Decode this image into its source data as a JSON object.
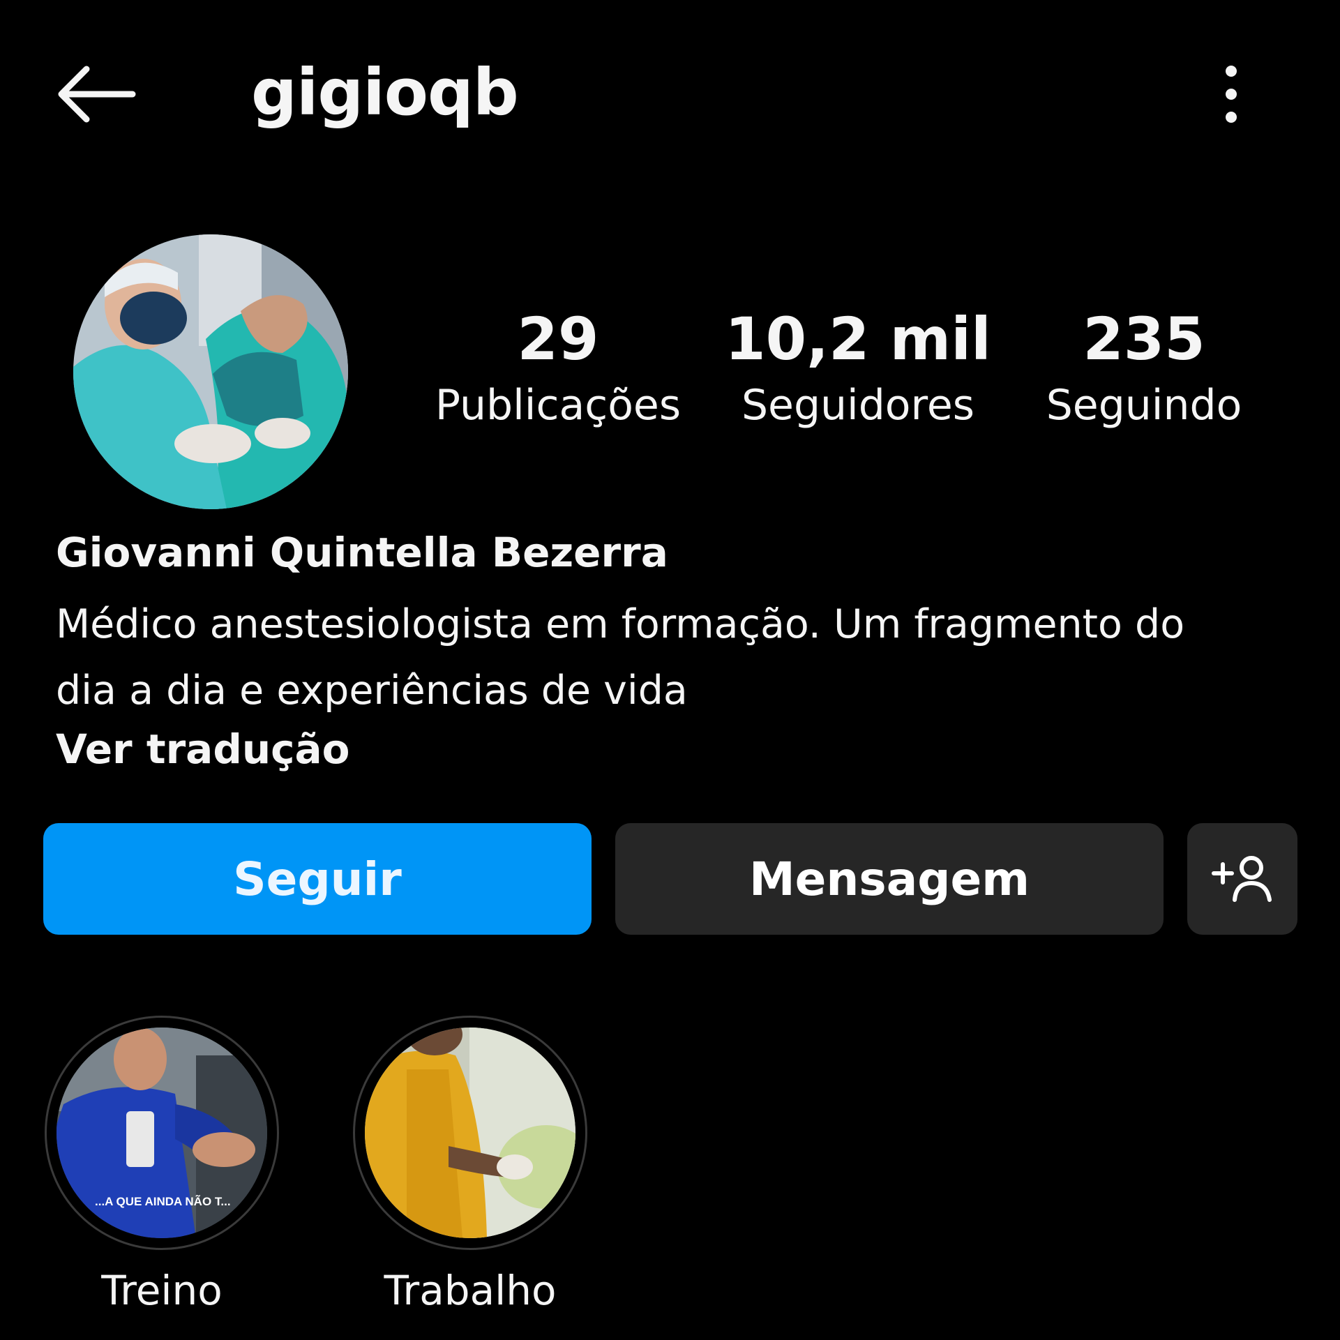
{
  "header": {
    "username": "gigioqb",
    "back_icon": "arrow-left-icon",
    "menu_icon": "more-vertical-icon"
  },
  "profile": {
    "stats": {
      "posts": {
        "value": "29",
        "label": "Publicações"
      },
      "followers": {
        "value": "10,2 mil",
        "label": "Seguidores"
      },
      "following": {
        "value": "235",
        "label": "Seguindo"
      }
    },
    "full_name": "Giovanni Quintella Bezerra",
    "bio": "Médico anestesiologista em formação. Um fragmento do dia a dia e experiências de vida",
    "translate_label": "Ver tradução"
  },
  "actions": {
    "follow_label": "Seguir",
    "message_label": "Mensagem",
    "add_user_icon": "add-user-icon"
  },
  "highlights": [
    {
      "label": "Treino",
      "overlay_text": "...A QUE AINDA NÃO T..."
    },
    {
      "label": "Trabalho"
    }
  ],
  "colors": {
    "background": "#000000",
    "text": "#f5f5f5",
    "follow_button": "#0095f6",
    "secondary_button": "#262626"
  }
}
